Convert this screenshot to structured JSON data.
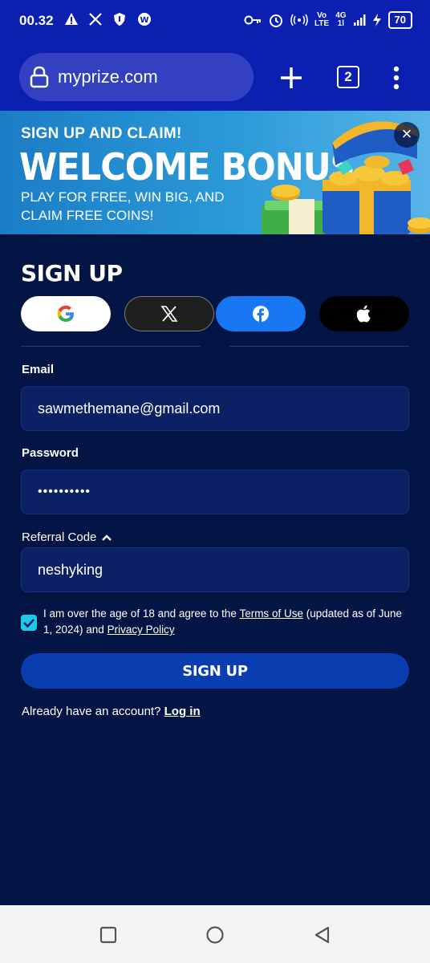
{
  "status_bar": {
    "time": "00.32",
    "network_top": "Vo",
    "network_bottom": "LTE",
    "gen_top": "4G",
    "gen_bottom": "1l",
    "battery": "70",
    "icons": [
      "warning-icon",
      "x-logo-icon",
      "shield-icon",
      "app-badge-icon",
      "key-icon",
      "alarm-icon",
      "hotspot-icon",
      "signal-icon",
      "charging-icon"
    ]
  },
  "browser": {
    "url": "myprize.com",
    "tab_count": "2"
  },
  "banner": {
    "line1": "SIGN UP AND CLAIM!",
    "headline": "WELCOME BONUS",
    "subtext": "PLAY FOR FREE, WIN BIG, AND CLAIM FREE COINS!",
    "close": "×"
  },
  "form": {
    "title": "SIGN UP",
    "social": [
      "google",
      "x",
      "facebook",
      "apple"
    ],
    "email_label": "Email",
    "email_value": "sawmethemane@gmail.com",
    "password_label": "Password",
    "password_value": "••••••••••",
    "referral_label": "Referral Code",
    "referral_value": "neshyking",
    "terms_prefix": "I am over the age of 18 and agree to the ",
    "terms_link": "Terms of Use",
    "terms_middle": " (updated as of June 1, 2024) and ",
    "privacy_link": "Privacy Policy",
    "checkbox_checked": true,
    "submit_label": "SIGN UP",
    "login_prompt": "Already have an account? ",
    "login_link": "Log in"
  },
  "colors": {
    "header_blue": "#0b1fb1",
    "background": "#031544",
    "input_bg": "#0b2163",
    "button": "#0a3db0",
    "check": "#1ec8e8",
    "facebook": "#1877f2"
  }
}
